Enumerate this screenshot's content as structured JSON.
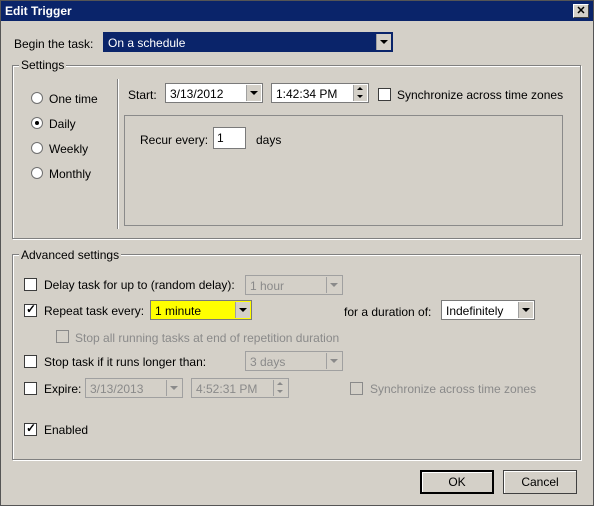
{
  "window": {
    "title": "Edit Trigger"
  },
  "begin": {
    "label": "Begin the task:",
    "value": "On a schedule"
  },
  "settings": {
    "legend": "Settings",
    "schedule_options": [
      "One time",
      "Daily",
      "Weekly",
      "Monthly"
    ],
    "selected": "Daily",
    "start_label": "Start:",
    "start_date": "3/13/2012",
    "start_time": "1:42:34 PM",
    "sync_label": "Synchronize across time zones",
    "sync_checked": false,
    "recur_label": "Recur every:",
    "recur_value": "1",
    "recur_unit": "days"
  },
  "advanced": {
    "legend": "Advanced settings",
    "delay": {
      "label": "Delay task for up to (random delay):",
      "checked": false,
      "value": "1 hour"
    },
    "repeat": {
      "label": "Repeat task every:",
      "checked": true,
      "value": "1 minute",
      "highlight": "#ffff00",
      "duration_label": "for a duration of:",
      "duration_value": "Indefinitely"
    },
    "stop_running": {
      "label": "Stop all running tasks at end of repetition duration",
      "checked": false
    },
    "stop_longer": {
      "label": "Stop task if it runs longer than:",
      "checked": false,
      "value": "3 days"
    },
    "expire": {
      "label": "Expire:",
      "checked": false,
      "date": "3/13/2013",
      "time": "4:52:31 PM",
      "sync_label": "Synchronize across time zones"
    },
    "enabled": {
      "label": "Enabled",
      "checked": true
    }
  },
  "buttons": {
    "ok": "OK",
    "cancel": "Cancel"
  },
  "colors": {
    "titlebar": "#0a246a",
    "face": "#d4d0c8",
    "highlight_field": "#ffff00",
    "selection": "#0a246a"
  }
}
